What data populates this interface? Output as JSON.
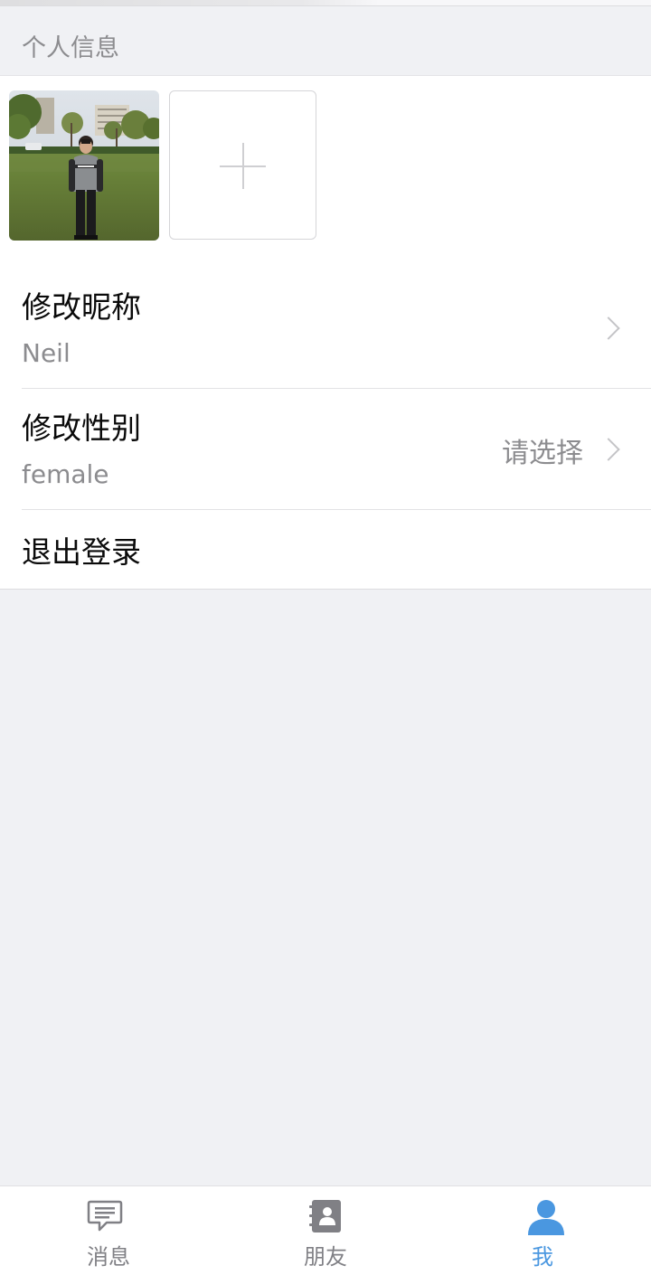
{
  "section": {
    "title": "个人信息"
  },
  "profile": {
    "avatar_icon": "user-photo",
    "upload_icon": "plus-icon"
  },
  "settings": [
    {
      "title": "修改昵称",
      "value": "Neil",
      "extra": ""
    },
    {
      "title": "修改性别",
      "value": "female",
      "extra": "请选择"
    },
    {
      "title": "退出登录"
    }
  ],
  "tabbar": {
    "active": "我",
    "items": [
      {
        "label": "消息",
        "icon": "message-icon"
      },
      {
        "label": "朋友",
        "icon": "contacts-icon"
      },
      {
        "label": "我",
        "icon": "person-icon"
      }
    ]
  },
  "colors": {
    "accent": "#4a97e0",
    "inactive": "#808085",
    "muted_text": "#8c8c8f",
    "background": "#f0f1f4"
  }
}
